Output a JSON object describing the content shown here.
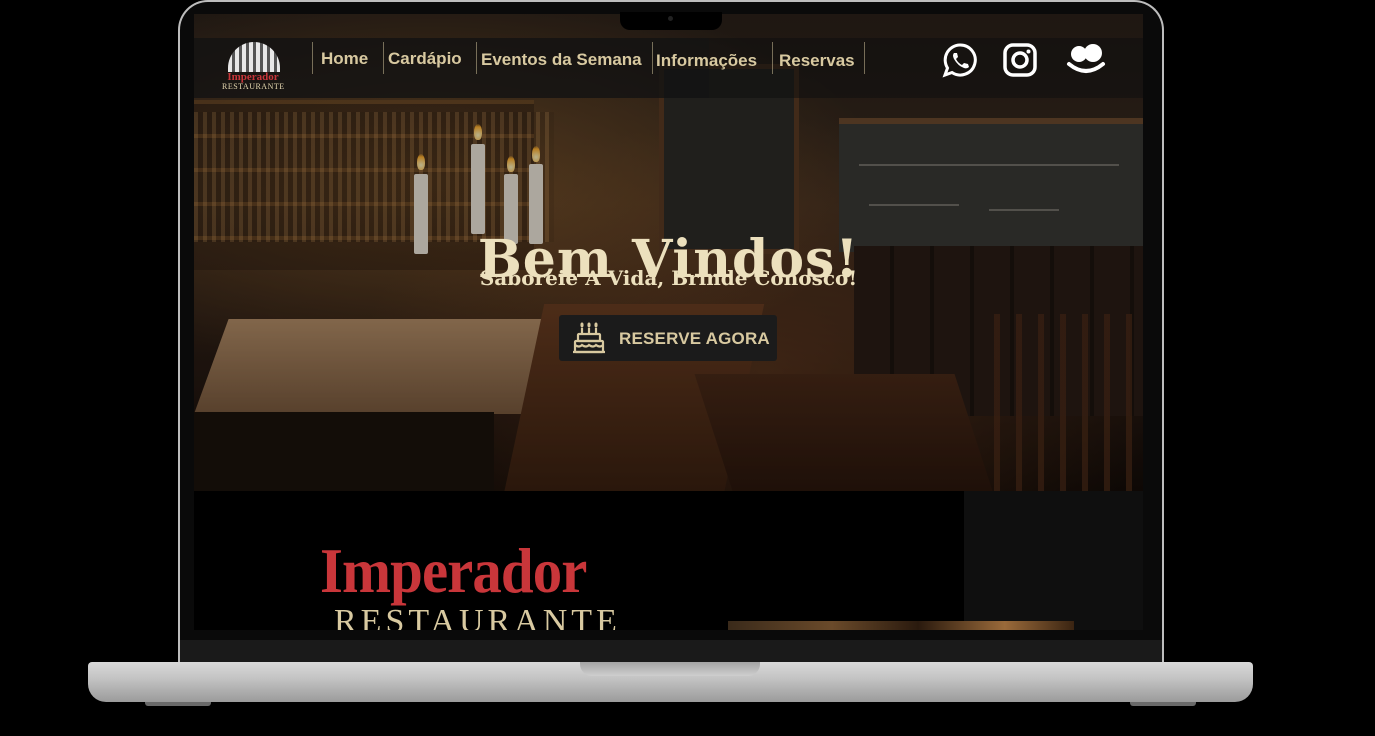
{
  "brand": {
    "logo_name": "Imperador",
    "logo_sub": "RESTAURANTE",
    "big_name": "Imperador",
    "big_sub": "RESTAURANTE"
  },
  "nav": {
    "items": [
      "Home",
      "Cardápio",
      "Eventos da Semana",
      "Informações",
      "Reservas"
    ]
  },
  "social": [
    "whatsapp-icon",
    "instagram-icon",
    "foursquare-icon"
  ],
  "hero": {
    "title": "Bem Vindos!",
    "subtitle": "Saboreie A Vida, Brinde Conosco!",
    "cta_label": "RESERVE AGORA",
    "cta_icon": "cake-icon"
  },
  "colors": {
    "accent": "#d8c9a0",
    "brand_red": "#c9363a",
    "cta_bg": "#1b1b1b"
  }
}
